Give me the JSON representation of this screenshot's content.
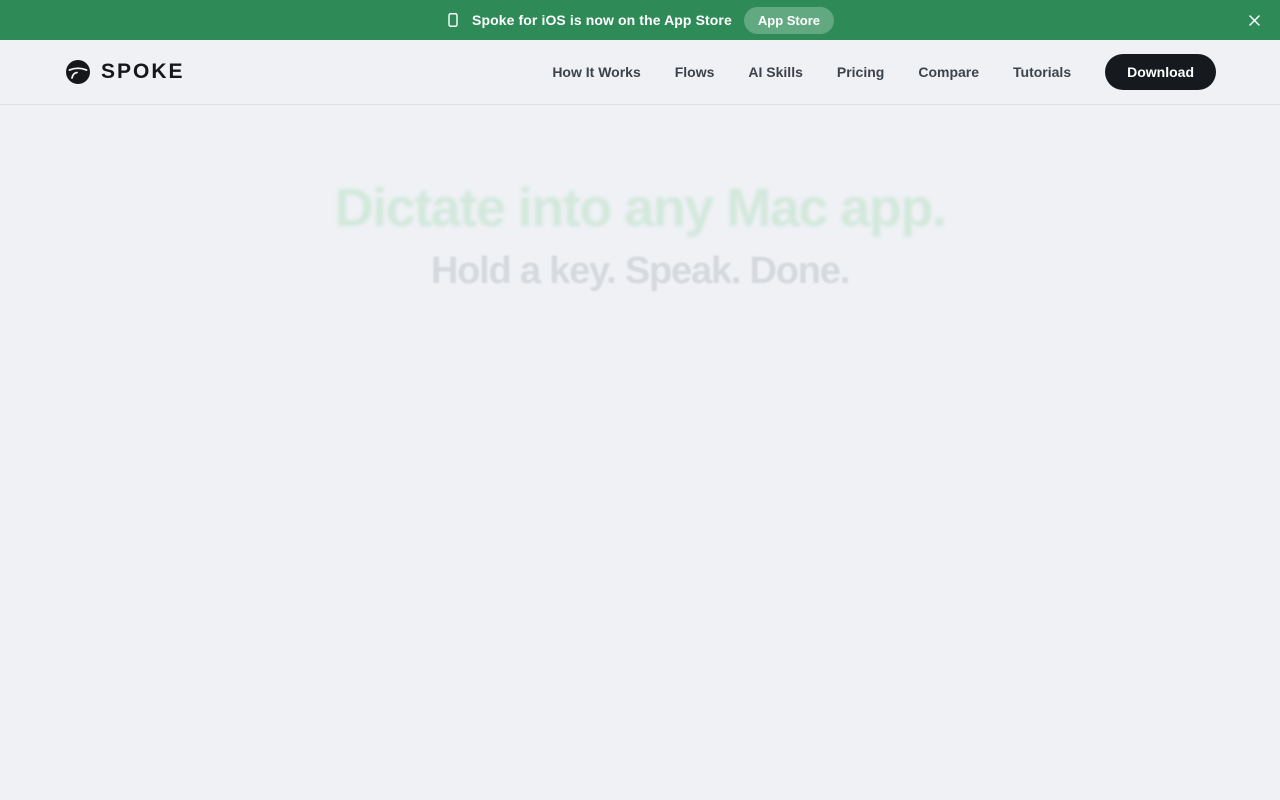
{
  "banner": {
    "icon": "phone-icon",
    "text": "Spoke for iOS is now on the App Store",
    "button_label": "App Store",
    "close_icon": "close-icon",
    "background_color": "#2e8b57"
  },
  "navbar": {
    "logo_icon": "spoke-logo-icon",
    "logo_text": "SPOKE",
    "links": [
      {
        "label": "How It Works"
      },
      {
        "label": "Flows"
      },
      {
        "label": "AI Skills"
      },
      {
        "label": "Pricing"
      },
      {
        "label": "Compare"
      },
      {
        "label": "Tutorials"
      }
    ],
    "download_label": "Download"
  },
  "hero": {
    "title": "Dictate into any Mac app.",
    "subtitle": "Hold a key. Speak. Done."
  },
  "colors": {
    "page_background": "#eff1f5",
    "accent_green": "#2e8b57",
    "dark_button": "#16191d"
  }
}
